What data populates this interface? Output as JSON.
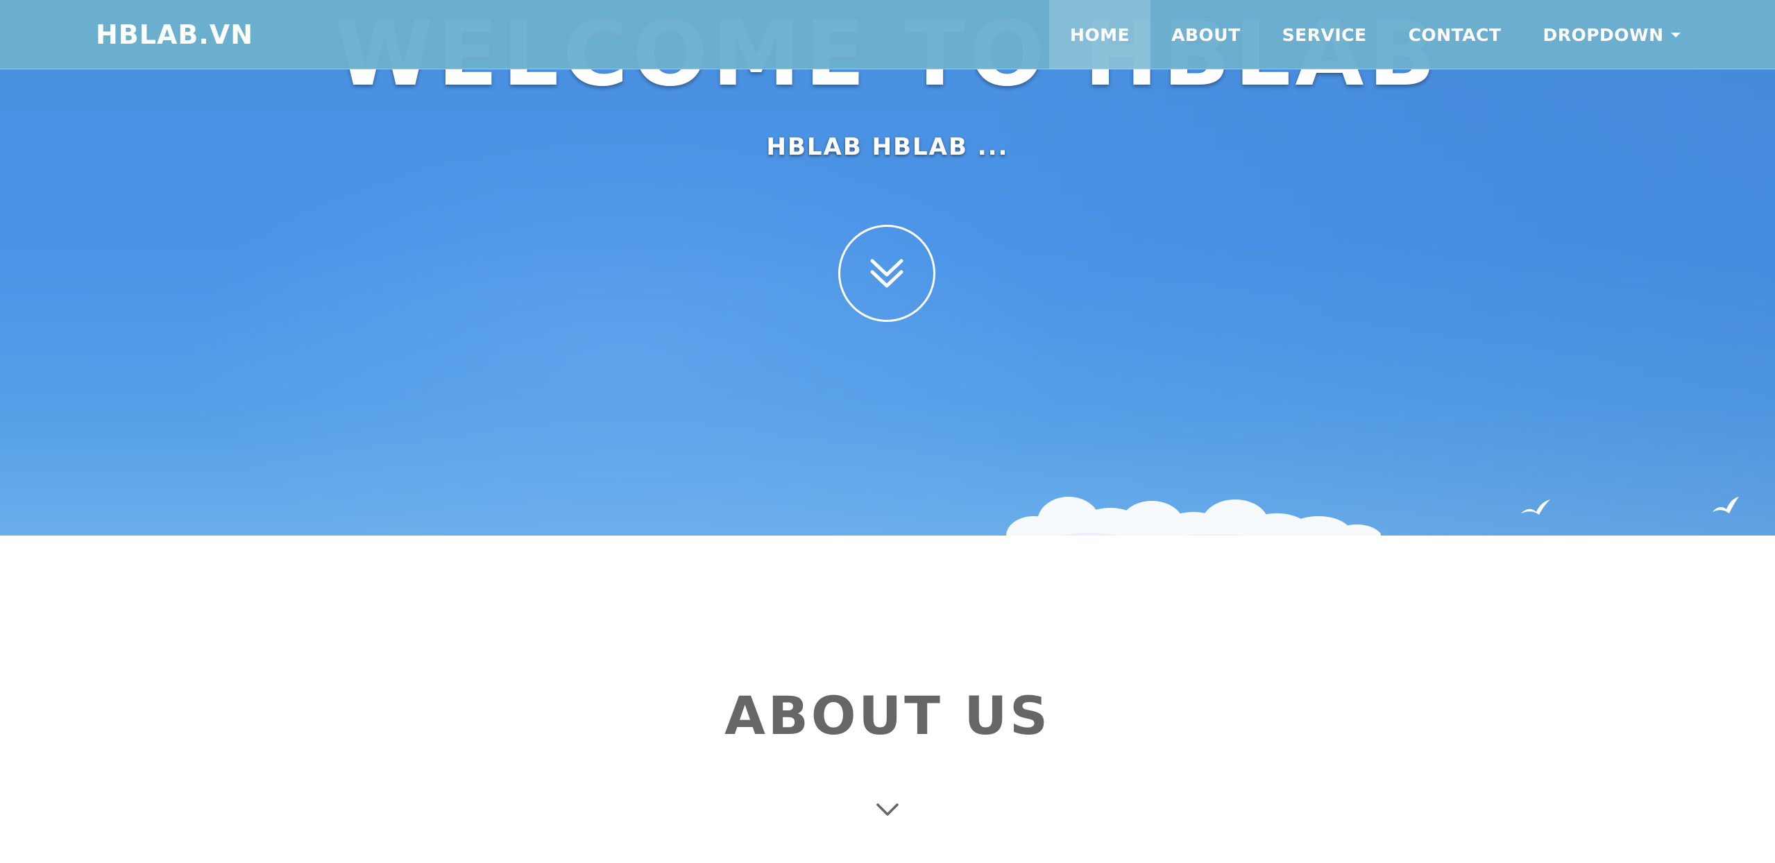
{
  "navbar": {
    "brand": "HBLAB.VN",
    "items": [
      {
        "label": "HOME",
        "active": true
      },
      {
        "label": "ABOUT",
        "active": false
      },
      {
        "label": "SERVICE",
        "active": false
      },
      {
        "label": "CONTACT",
        "active": false
      },
      {
        "label": "DROPDOWN",
        "active": false,
        "has_caret": true
      }
    ]
  },
  "hero": {
    "title": "WELCOME TO HBLAB",
    "subtitle": "HBLAB HBLAB ...",
    "scroll_icon": "double-chevron-down-icon"
  },
  "about": {
    "title": "ABOUT US",
    "chevron_icon": "chevron-down-icon"
  },
  "colors": {
    "navbar": "#6cb0ce",
    "sky": "#4a93e6",
    "about_title": "#666666",
    "white": "#ffffff"
  }
}
